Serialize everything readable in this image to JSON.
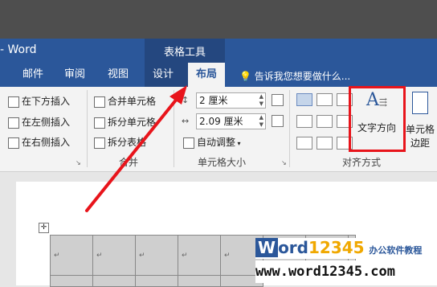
{
  "window": {
    "app_title": "- Word",
    "context_title": "表格工具"
  },
  "tabs": [
    {
      "label": "邮件"
    },
    {
      "label": "审阅"
    },
    {
      "label": "视图"
    },
    {
      "label": "设计"
    },
    {
      "label": "布局"
    }
  ],
  "tell_me": "告诉我您想要做什么...",
  "rows_cols": {
    "insert_below": "在下方插入",
    "insert_left": "在左侧插入",
    "insert_right": "在右侧插入"
  },
  "merge": {
    "merge_cells": "合并单元格",
    "split_cells": "拆分单元格",
    "split_table": "拆分表格",
    "label": "合并"
  },
  "cell_size": {
    "height": "2 厘米",
    "width": "2.09 厘米",
    "autofit": "自动调整",
    "label": "单元格大小"
  },
  "alignment": {
    "text_direction": "文字方向",
    "cell_margins_line1": "单元格",
    "cell_margins_line2": "边距",
    "label": "对齐方式"
  },
  "table_cells": [
    "↵",
    "↵",
    "↵",
    "↵",
    "↵",
    "↵",
    "↵",
    "↵"
  ],
  "watermark": {
    "brand_w": "W",
    "brand_ord": "ord",
    "brand_num": "12345",
    "brand_suffix": "办公软件教程",
    "url": "www.word12345.com"
  },
  "colors": {
    "word_blue": "#2b579a",
    "highlight_red": "#e8141b"
  }
}
